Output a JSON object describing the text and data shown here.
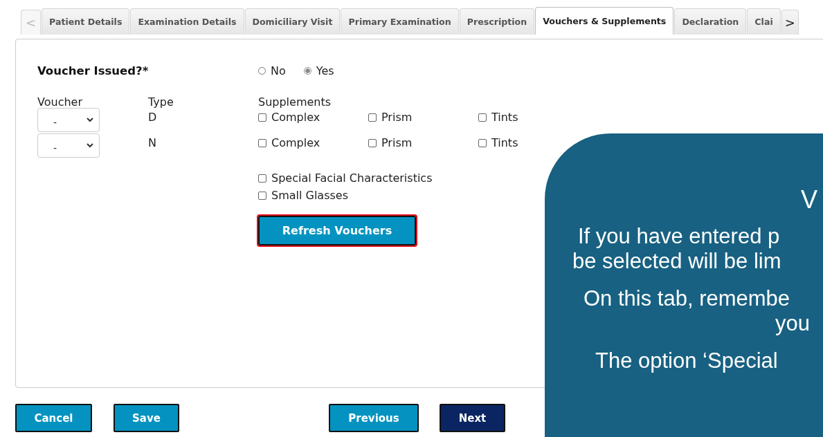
{
  "tabs": {
    "prev": "<",
    "next": ">",
    "items": [
      {
        "label": "Patient Details",
        "selected": false
      },
      {
        "label": "Examination Details",
        "selected": false
      },
      {
        "label": "Domiciliary Visit",
        "selected": false
      },
      {
        "label": "Primary Examination",
        "selected": false
      },
      {
        "label": "Prescription",
        "selected": false
      },
      {
        "label": "Vouchers & Supplements",
        "selected": true
      },
      {
        "label": "Declaration",
        "selected": false
      },
      {
        "label": "Clai",
        "selected": false
      }
    ]
  },
  "voucher_issued": {
    "label": "Voucher Issued?*",
    "options": [
      {
        "label": "No",
        "selected": false
      },
      {
        "label": "Yes",
        "selected": true
      }
    ]
  },
  "vouchers": {
    "columns": [
      "Voucher",
      "Type",
      "Supplements"
    ],
    "rows": [
      {
        "voucher": "-",
        "type": "D",
        "supplements": [
          {
            "label": "Complex",
            "checked": false
          },
          {
            "label": "Prism",
            "checked": false
          },
          {
            "label": "Tints",
            "checked": false
          }
        ]
      },
      {
        "voucher": "-",
        "type": "N",
        "supplements": [
          {
            "label": "Complex",
            "checked": false
          },
          {
            "label": "Prism",
            "checked": false
          },
          {
            "label": "Tints",
            "checked": false
          }
        ]
      }
    ]
  },
  "extra_supplements": [
    {
      "label": "Special Facial Characteristics",
      "checked": false
    },
    {
      "label": "Small Glasses",
      "checked": false
    }
  ],
  "refresh_button": {
    "label": "Refresh Vouchers",
    "focused": true
  },
  "footer": {
    "left": [
      {
        "label": "Cancel",
        "kind": "secondary"
      },
      {
        "label": "Save",
        "kind": "secondary"
      }
    ],
    "right": [
      {
        "label": "Previous",
        "kind": "secondary"
      },
      {
        "label": "Next",
        "kind": "primary"
      }
    ]
  },
  "callout": {
    "heading": "V",
    "lines": [
      "If you have entered p",
      "be selected will be lim",
      "On this tab, remembe",
      "you",
      "The option ‘Special"
    ]
  }
}
